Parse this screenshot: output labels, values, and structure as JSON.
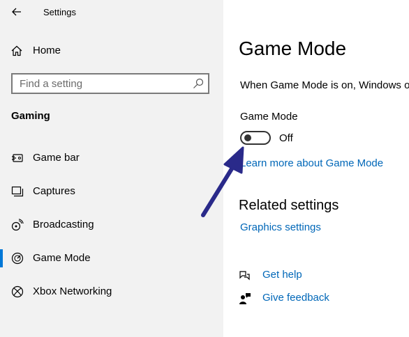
{
  "window": {
    "title": "Settings"
  },
  "sidebar": {
    "home_label": "Home",
    "search_placeholder": "Find a setting",
    "section_title": "Gaming",
    "items": [
      {
        "label": "Game bar",
        "icon": "game-bar-icon"
      },
      {
        "label": "Captures",
        "icon": "captures-icon"
      },
      {
        "label": "Broadcasting",
        "icon": "broadcasting-icon"
      },
      {
        "label": "Game Mode",
        "icon": "game-mode-icon",
        "selected": true
      },
      {
        "label": "Xbox Networking",
        "icon": "xbox-icon"
      }
    ]
  },
  "main": {
    "title": "Game Mode",
    "description": "When Game Mode is on, Windows o",
    "toggle": {
      "label": "Game Mode",
      "state_label": "Off",
      "on": false
    },
    "learn_more": "Learn more about Game Mode",
    "related_title": "Related settings",
    "graphics_link": "Graphics settings",
    "get_help": "Get help",
    "give_feedback": "Give feedback"
  },
  "colors": {
    "accent": "#0078d7",
    "link": "#0067b8",
    "arrow": "#2a2a8a",
    "sidebar_bg": "#f2f2f2"
  }
}
